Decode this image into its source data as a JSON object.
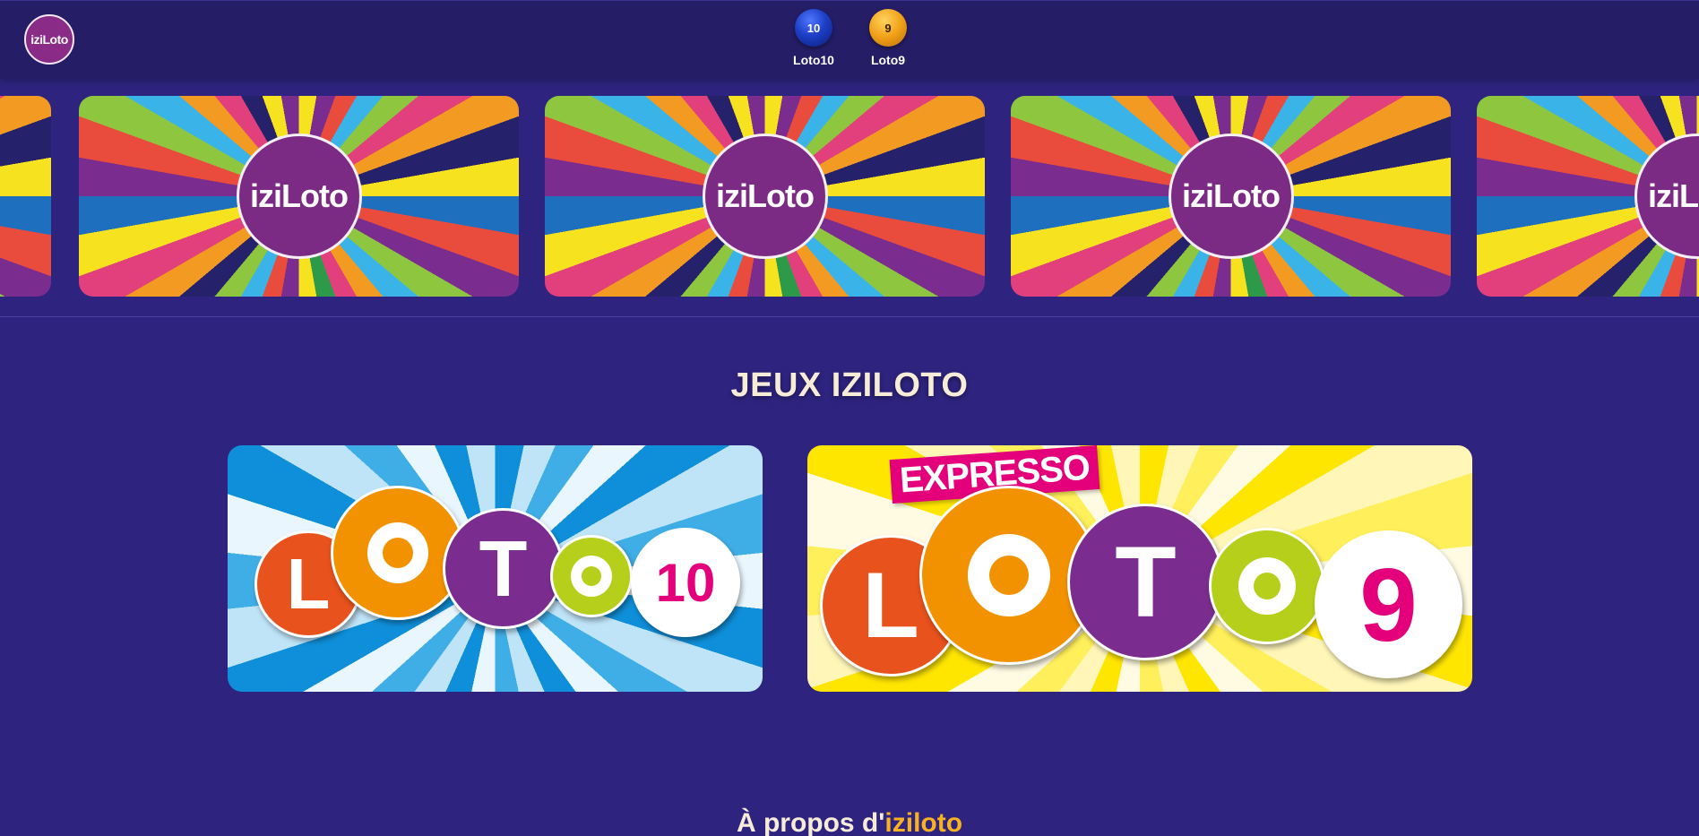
{
  "header": {
    "logo_text": "iziLoto",
    "games": [
      {
        "ball_number": "10",
        "label": "Loto10",
        "color": "#1d3fc7"
      },
      {
        "ball_number": "9",
        "label": "Loto9",
        "color": "#f0a017"
      }
    ]
  },
  "carousel": {
    "slide_logo_text": "iziLoto",
    "slides": 5
  },
  "section": {
    "title": "JEUX IZILOTO"
  },
  "cards": {
    "loto10": {
      "letters": [
        "L",
        "O",
        "T",
        "O"
      ],
      "number": "10"
    },
    "loto9": {
      "tag": "EXPRESSO",
      "letters": [
        "L",
        "O",
        "T",
        "O"
      ],
      "number": "9"
    }
  },
  "about": {
    "prefix": "À propos d'",
    "brand": "iziloto"
  },
  "colors": {
    "background": "#2e2480",
    "header": "#251d66",
    "brand_purple": "#7b2b84",
    "accent_orange": "#f9b21f",
    "loto_orange": "#e8521c",
    "loto_amber": "#f39200",
    "loto_purple": "#7b2d8f",
    "loto_green": "#b5cf1a",
    "loto_pink": "#e4007a"
  }
}
